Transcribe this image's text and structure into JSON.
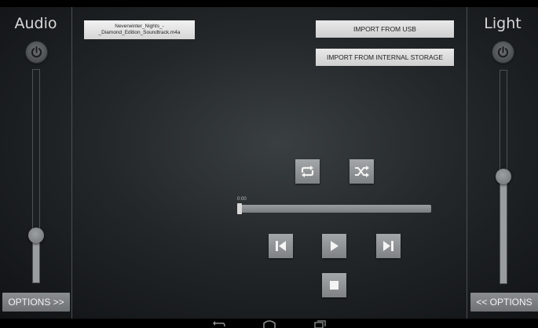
{
  "audio_panel": {
    "title": "Audio",
    "power_icon": "power-icon",
    "volume_level": 0.22,
    "options_label": "OPTIONS >>"
  },
  "light_panel": {
    "title": "Light",
    "power_icon": "power-icon",
    "brightness_level": 0.5,
    "options_label": "<< OPTIONS"
  },
  "track": {
    "name_line1": "Neverwinter_Nights_-",
    "name_line2": "_Diamond_Edition_Soundtrack.m4a",
    "elapsed": "0:00",
    "progress": 0.0
  },
  "import": {
    "usb_label": "IMPORT FROM USB",
    "internal_label": "IMPORT FROM INTERNAL STORAGE"
  },
  "controls": {
    "icons": [
      "repeat-icon",
      "shuffle-icon",
      "skip-previous-icon",
      "play-icon",
      "skip-next-icon",
      "stop-icon"
    ]
  },
  "navbar": {
    "icons": [
      "back-icon",
      "home-icon",
      "recents-icon"
    ]
  },
  "colors": {
    "button_gray": "#8b8e90",
    "slider_fill": "#9a9d9f",
    "panel_text": "#d9d9d9"
  }
}
